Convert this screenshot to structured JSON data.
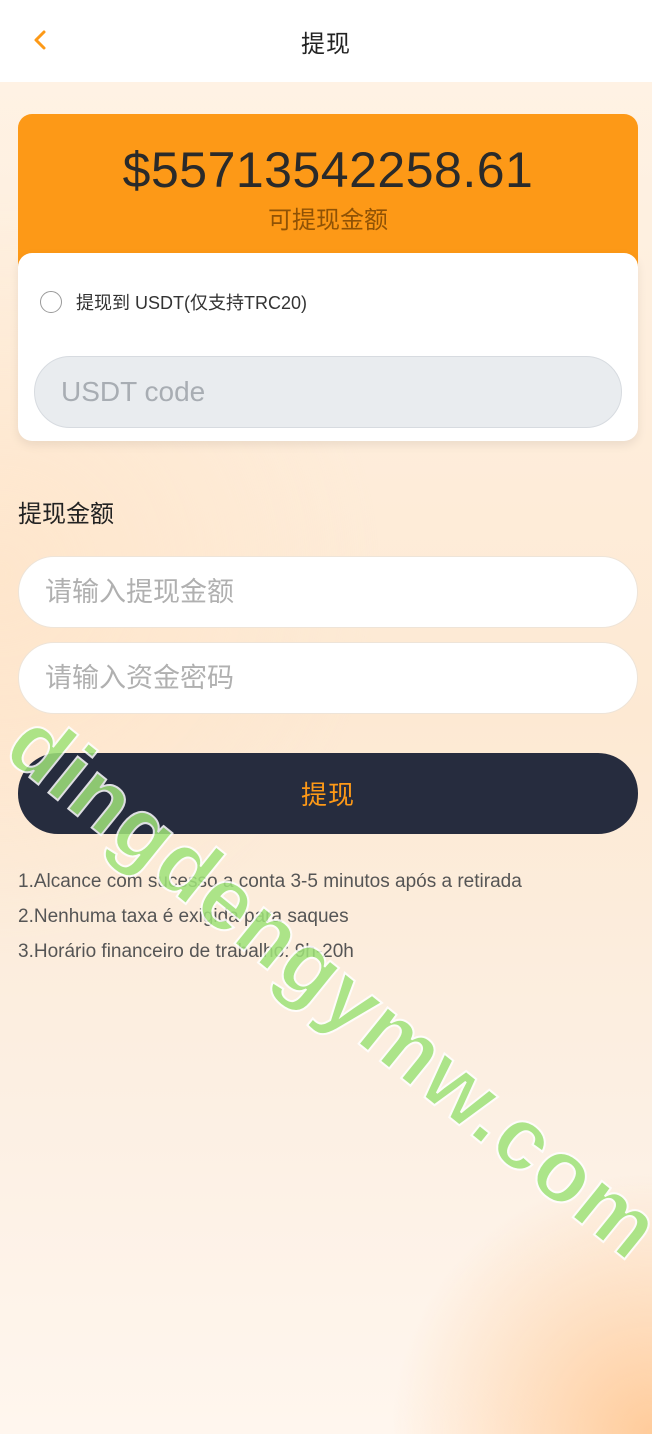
{
  "header": {
    "title": "提现",
    "back_icon": "chevron-left-icon"
  },
  "balance": {
    "amount": "$55713542258.61",
    "label": "可提现金额"
  },
  "usdt": {
    "option_label": "提现到 USDT(仅支持TRC20)",
    "code_placeholder": "USDT code",
    "code_value": ""
  },
  "withdraw": {
    "section_title": "提现金额",
    "amount_placeholder": "请输入提现金额",
    "password_placeholder": "请输入资金密码",
    "submit_label": "提现"
  },
  "notes": [
    "1.Alcance com sucesso a conta 3-5 minutos após a retirada",
    "2.Nenhuma taxa é exigida para saques",
    "3.Horário financeiro de trabalho: 9h-20h"
  ],
  "watermark": "dingdengymw.com",
  "colors": {
    "accent": "#fd9917",
    "button_bg": "#262c3e",
    "watermark": "#9fe37a"
  }
}
